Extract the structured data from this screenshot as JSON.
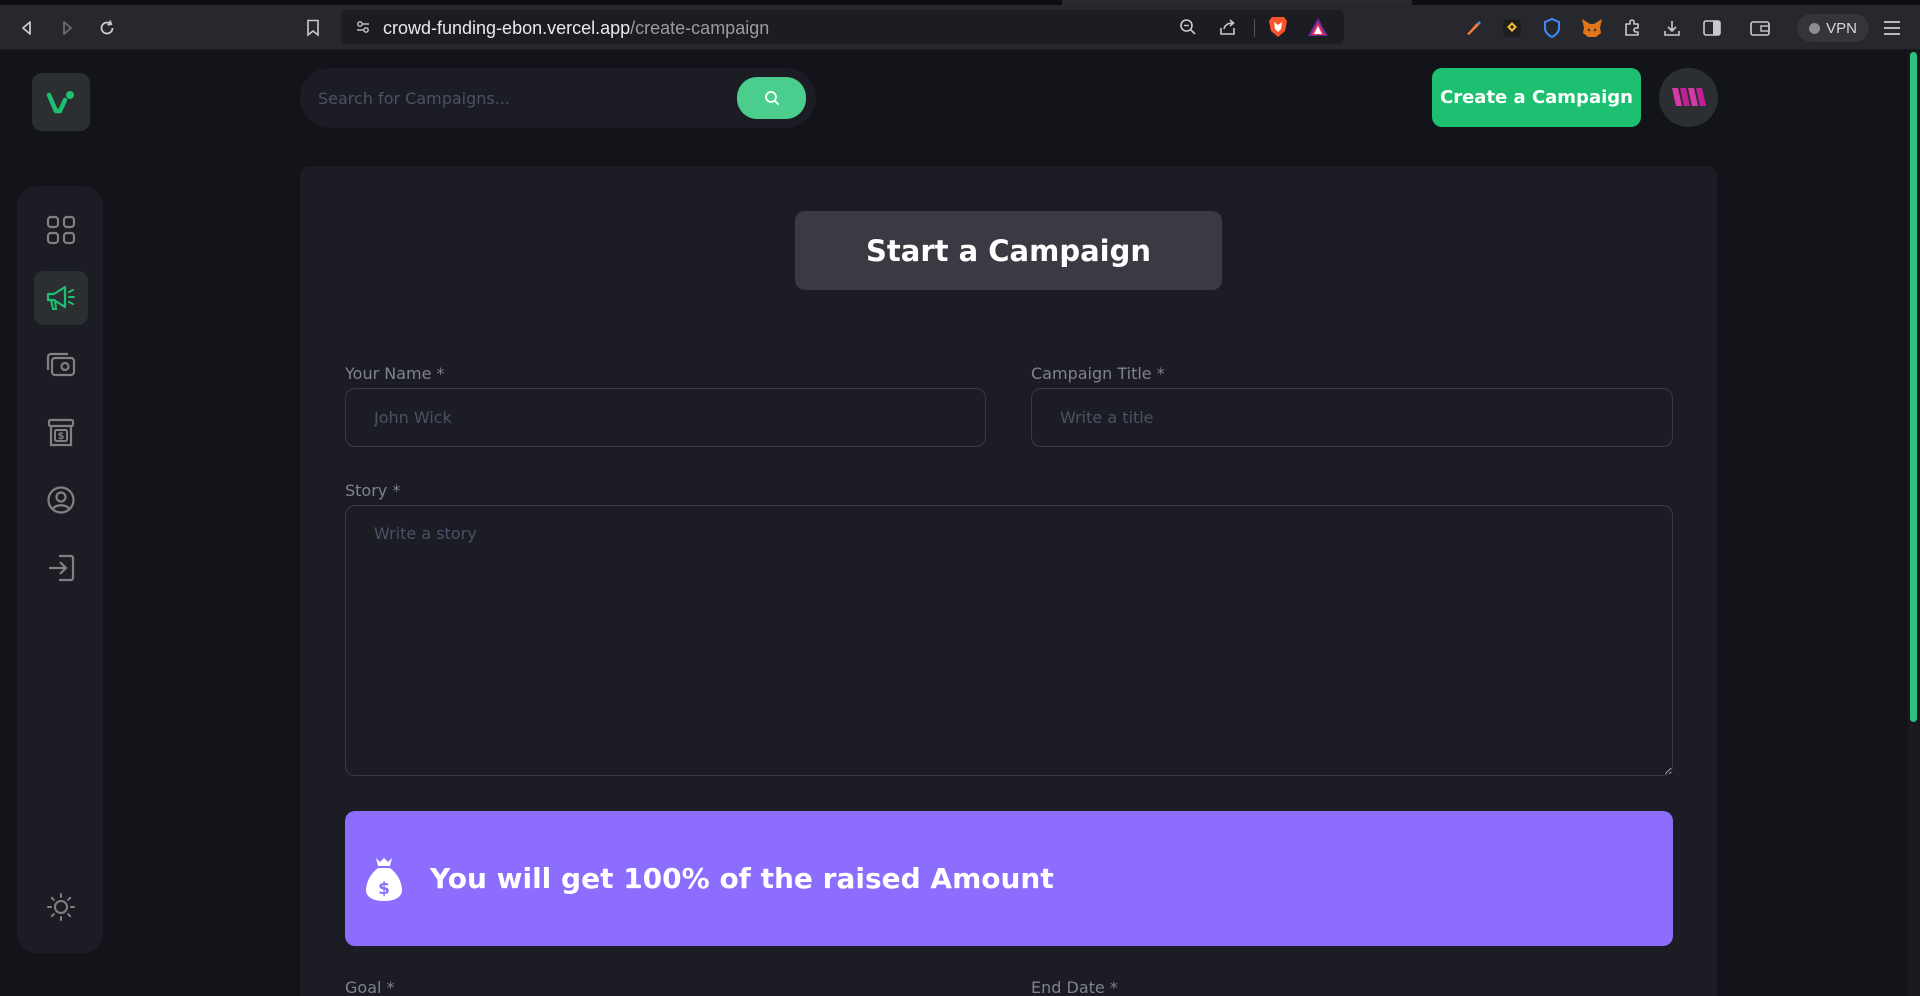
{
  "browser": {
    "url_host": "crowd-funding-ebon.vercel.app",
    "url_path": "/create-campaign",
    "vpn_label": "VPN"
  },
  "sidebar": {
    "items": [
      {
        "name": "dashboard",
        "icon": "grid-icon",
        "active": false
      },
      {
        "name": "campaign",
        "icon": "megaphone-icon",
        "active": true
      },
      {
        "name": "payment",
        "icon": "wallet-icon",
        "active": false
      },
      {
        "name": "withdraw",
        "icon": "cash-register-icon",
        "active": false
      },
      {
        "name": "profile",
        "icon": "user-circle-icon",
        "active": false
      },
      {
        "name": "logout",
        "icon": "logout-icon",
        "active": false
      }
    ],
    "theme_toggle_icon": "sun-icon"
  },
  "header": {
    "search_placeholder": "Search for Campaigns...",
    "create_label": "Create a Campaign"
  },
  "form": {
    "title": "Start a Campaign",
    "name_label": "Your Name *",
    "name_placeholder": "John Wick",
    "title_label": "Campaign Title *",
    "title_placeholder": "Write a title",
    "story_label": "Story *",
    "story_placeholder": "Write a story",
    "banner_text": "You will get 100% of the raised Amount",
    "goal_label": "Goal *",
    "end_date_label": "End Date *"
  },
  "colors": {
    "accent": "#1dc071",
    "search_button": "#4acd8d",
    "banner": "#8c6dfd",
    "card_bg": "#1c1c24",
    "page_bg": "#13131a"
  }
}
